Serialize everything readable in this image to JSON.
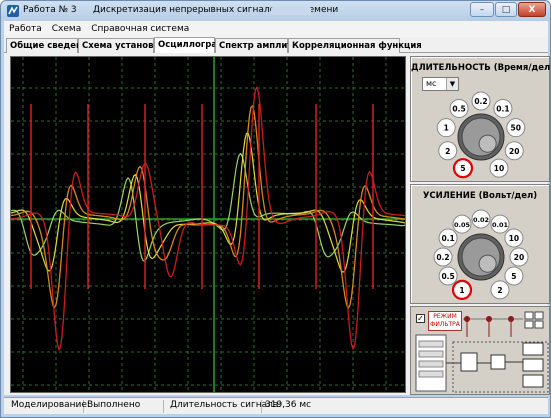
{
  "window": {
    "title_left": "Работа № 3",
    "title": "Дискретизация непрерывных сигналов по времени",
    "controls": {
      "minimize": "–",
      "maximize": "□",
      "close": "X"
    }
  },
  "menu": [
    "Работа",
    "Схема",
    "Справочная система"
  ],
  "tabs": [
    {
      "label": "Общие сведения",
      "active": false
    },
    {
      "label": "Схема установки",
      "active": false
    },
    {
      "label": "Осциллограф",
      "active": true
    },
    {
      "label": "Спектр амплитуд",
      "active": false
    },
    {
      "label": "Корреляционная функция",
      "active": false
    }
  ],
  "duration_panel": {
    "title": "ДЛИТЕЛЬНОСТЬ (Время/дел)",
    "unit": "мс",
    "dial_values": [
      "5",
      "2",
      "1",
      "0.5",
      "0.2",
      "0.1",
      "50",
      "20",
      "10"
    ],
    "selected": "5"
  },
  "gain_panel": {
    "title": "УСИЛЕНИЕ (Вольт/дел)",
    "dial_values": [
      "1",
      "0.5",
      "0.2",
      "0.1",
      "0.05",
      "0.02",
      "0.01",
      "10",
      "20",
      "5",
      "2"
    ],
    "selected": "1"
  },
  "mode_panel": {
    "checked": true,
    "label": "РЕЖИМ ФИЛЬТРА"
  },
  "status": {
    "modeling_label": "Моделирование:",
    "modeling_value": "Выполнено",
    "duration_label": "Длительность сигнала:",
    "duration_value": "319,36 мс"
  },
  "colors": {
    "scope_bg": "#000000",
    "grid": "#2e6b2e",
    "trace_red": "#d42020",
    "trace_orange": "#e09020",
    "trace_yellow": "#e8e840",
    "trace_lightgreen": "#9ee070",
    "dial_highlight": "#e00000"
  }
}
